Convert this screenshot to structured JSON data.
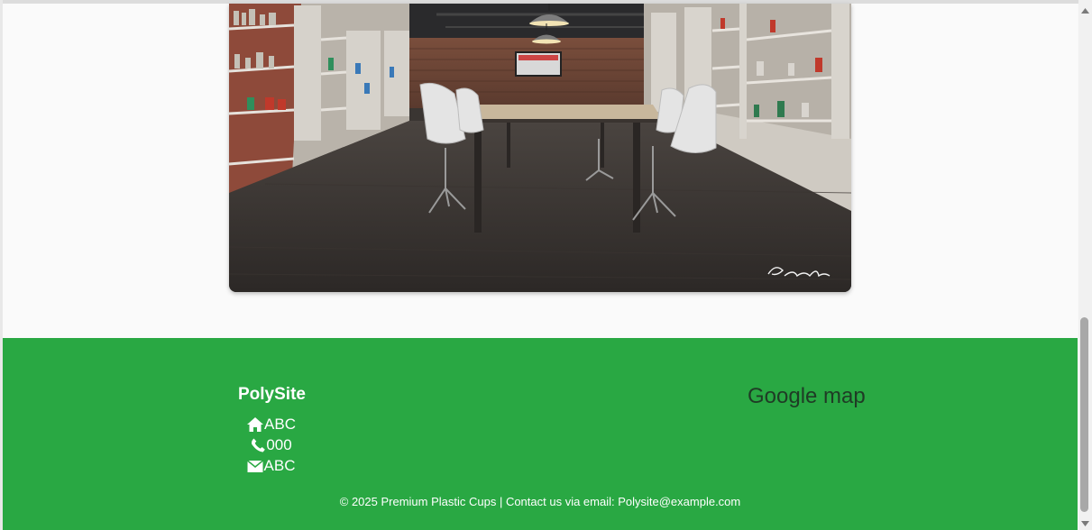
{
  "photo": {
    "description_icon": "office-photo"
  },
  "footer": {
    "brand": "PolySite",
    "address": "ABC",
    "phone": "000",
    "email_line": "ABC",
    "map_title": "Google map",
    "copyright": "© 2025 Premium Plastic Cups | Contact us via email: Polysite@example.com",
    "icons": {
      "address": "home-icon",
      "phone": "phone-icon",
      "email": "envelope-icon"
    }
  },
  "colors": {
    "footer_bg": "#29a843",
    "footer_text": "#ffffff",
    "map_title": "#1f3b25",
    "page_bg": "#fafafa"
  }
}
